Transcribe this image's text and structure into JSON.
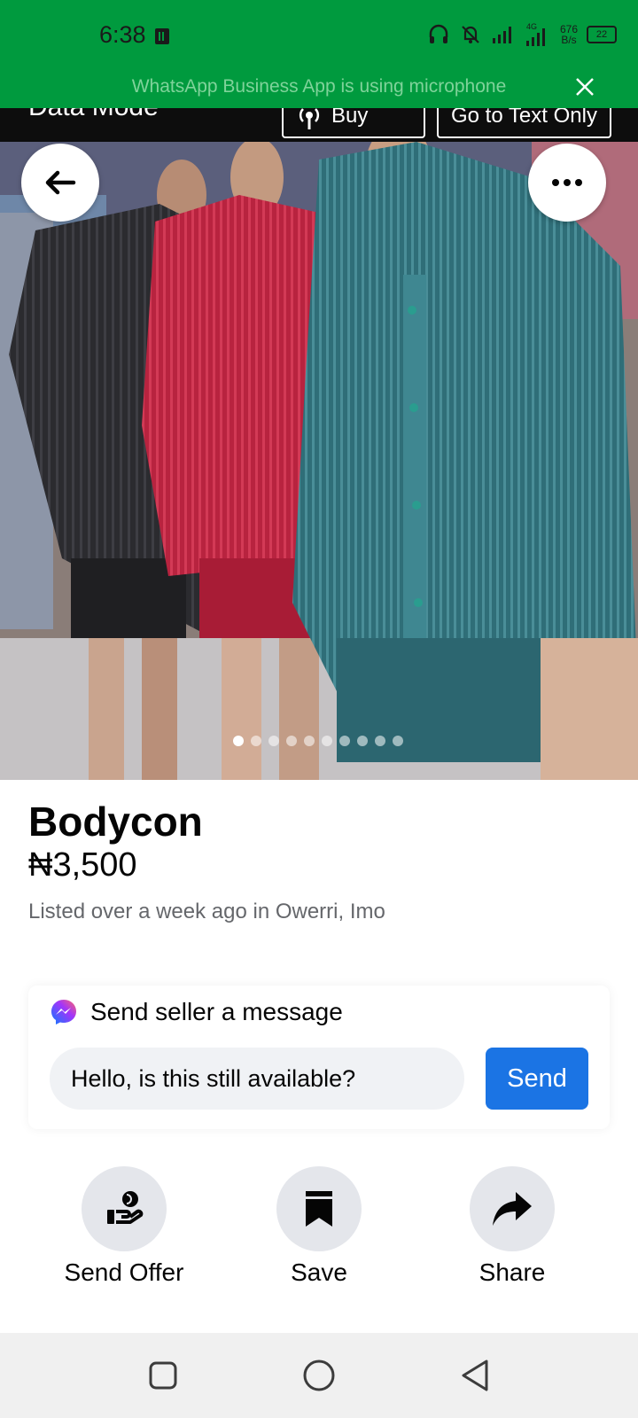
{
  "status_bar": {
    "time": "6:38",
    "network_speed": "676",
    "network_unit": "B/s",
    "battery": "22",
    "icons": [
      "sim-card-icon",
      "headphones-icon",
      "bell-off-icon",
      "signal-icon",
      "4g-signal-icon",
      "battery-icon"
    ]
  },
  "notification": {
    "text": "WhatsApp Business App is using microphone"
  },
  "data_mode": {
    "title": "Data Mode",
    "buy_label": "Buy Data",
    "text_only_label": "Go to Text Only"
  },
  "gallery": {
    "image_count": 10,
    "active_index": 0
  },
  "listing": {
    "title": "Bodycon",
    "price": "₦3,500",
    "meta": "Listed over a week ago in Owerri, Imo"
  },
  "message": {
    "heading": "Send seller a message",
    "input_value": "Hello, is this still available?",
    "send_label": "Send"
  },
  "actions": {
    "send_offer": "Send Offer",
    "save": "Save",
    "share": "Share"
  },
  "colors": {
    "status_bar": "#009a3e",
    "send_button": "#1b74e4"
  }
}
